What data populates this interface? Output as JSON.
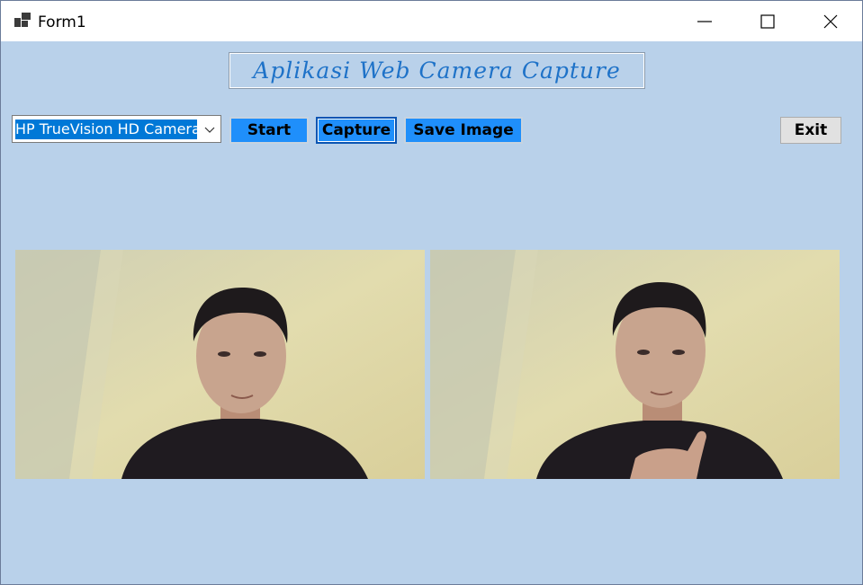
{
  "window": {
    "title": "Form1"
  },
  "caption_buttons": {
    "minimize": "minimize-icon",
    "maximize": "maximize-icon",
    "close": "close-icon"
  },
  "header": {
    "banner_text": "Aplikasi Web Camera Capture"
  },
  "camera_select": {
    "selected": "HP TrueVision HD Camera"
  },
  "buttons": {
    "start": "Start",
    "capture": "Capture",
    "save_image": "Save Image",
    "exit": "Exit"
  },
  "colors": {
    "client_bg": "#b9d1ea",
    "accent_button": "#1f8ffb",
    "banner_text": "#1e72c8",
    "selection": "#0078d7"
  }
}
